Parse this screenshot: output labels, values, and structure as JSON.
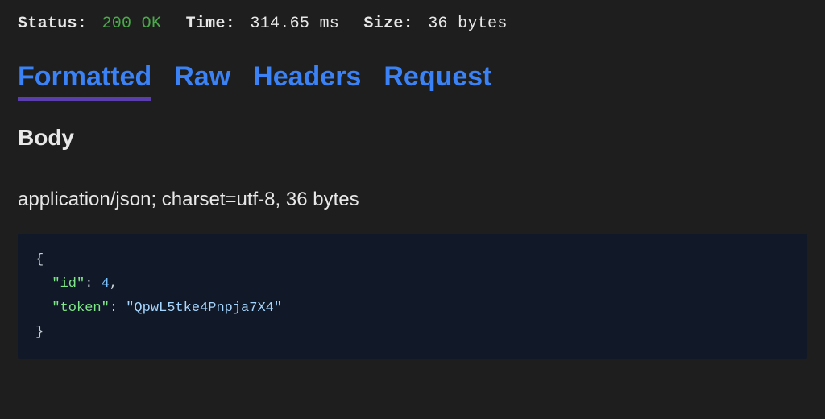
{
  "status_line": {
    "status_label": "Status:",
    "status_value": "200 OK",
    "time_label": "Time:",
    "time_value": "314.65 ms",
    "size_label": "Size:",
    "size_value": "36 bytes"
  },
  "tabs": {
    "formatted": "Formatted",
    "raw": "Raw",
    "headers": "Headers",
    "request": "Request"
  },
  "body": {
    "heading": "Body",
    "meta": "application/json; charset=utf-8, 36 bytes",
    "json": {
      "open": "{",
      "line1_key": "\"id\"",
      "line1_sep": ": ",
      "line1_val": "4",
      "line1_comma": ",",
      "line2_key": "\"token\"",
      "line2_sep": ": ",
      "line2_val": "\"QpwL5tke4Pnpja7X4\"",
      "close": "}"
    }
  }
}
